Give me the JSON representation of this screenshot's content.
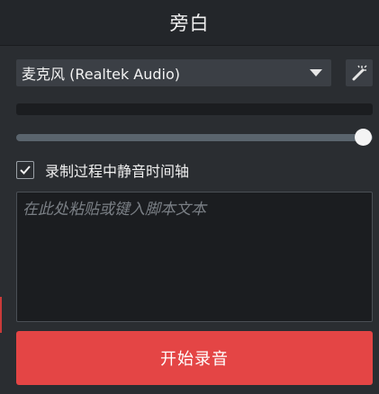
{
  "header": {
    "title": "旁白"
  },
  "microphone": {
    "selected": "麦克风 (Realtek Audio)"
  },
  "volume_slider": {
    "level_fraction": 1.0
  },
  "options": {
    "mute_timeline_label": "录制过程中静音时间轴",
    "mute_timeline_checked": true
  },
  "script": {
    "placeholder": "在此处粘贴或键入脚本文本"
  },
  "record": {
    "label": "开始录音"
  },
  "colors": {
    "record_button": "#e44545",
    "panel_bg": "#2a2d31",
    "header_bg": "#23262a"
  }
}
